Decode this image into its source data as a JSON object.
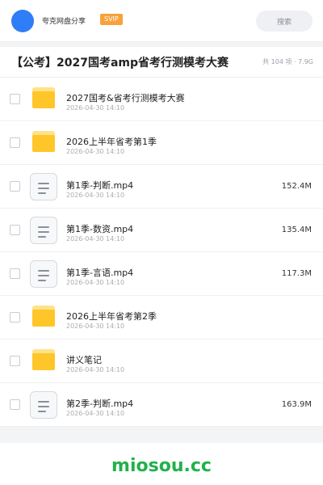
{
  "header": {
    "brand": "夸克网盘分享",
    "badge": "SVIP",
    "search_placeholder": "搜索"
  },
  "share": {
    "title": "【公考】2027国考amp省考行测模考大赛",
    "meta": "共 104 项 · 7.9G"
  },
  "files": [
    {
      "type": "folder",
      "name": "2027国考&省考行测模考大赛",
      "date": "2026-04-30 14:10",
      "size": ""
    },
    {
      "type": "folder",
      "name": "2026上半年省考第1季",
      "date": "2026-04-30 14:10",
      "size": ""
    },
    {
      "type": "file",
      "name": "第1季-判断.mp4",
      "date": "2026-04-30 14:10",
      "size": "152.4M"
    },
    {
      "type": "file",
      "name": "第1季-数资.mp4",
      "date": "2026-04-30 14:10",
      "size": "135.4M"
    },
    {
      "type": "file",
      "name": "第1季-言语.mp4",
      "date": "2026-04-30 14:10",
      "size": "117.3M"
    },
    {
      "type": "folder",
      "name": "2026上半年省考第2季",
      "date": "2026-04-30 14:10",
      "size": ""
    },
    {
      "type": "folder",
      "name": "讲义笔记",
      "date": "2026-04-30 14:10",
      "size": ""
    },
    {
      "type": "file",
      "name": "第2季-判断.mp4",
      "date": "2026-04-30 14:10",
      "size": "163.9M"
    }
  ],
  "footer": {
    "watermark": "miosou.cc"
  },
  "colors": {
    "avatar": "#2f7df7",
    "badge": "#f7a23b",
    "folder": "#ffc629",
    "watermark": "#21b14b"
  },
  "icons": {
    "folder": "folder-icon",
    "file": "document-icon"
  }
}
